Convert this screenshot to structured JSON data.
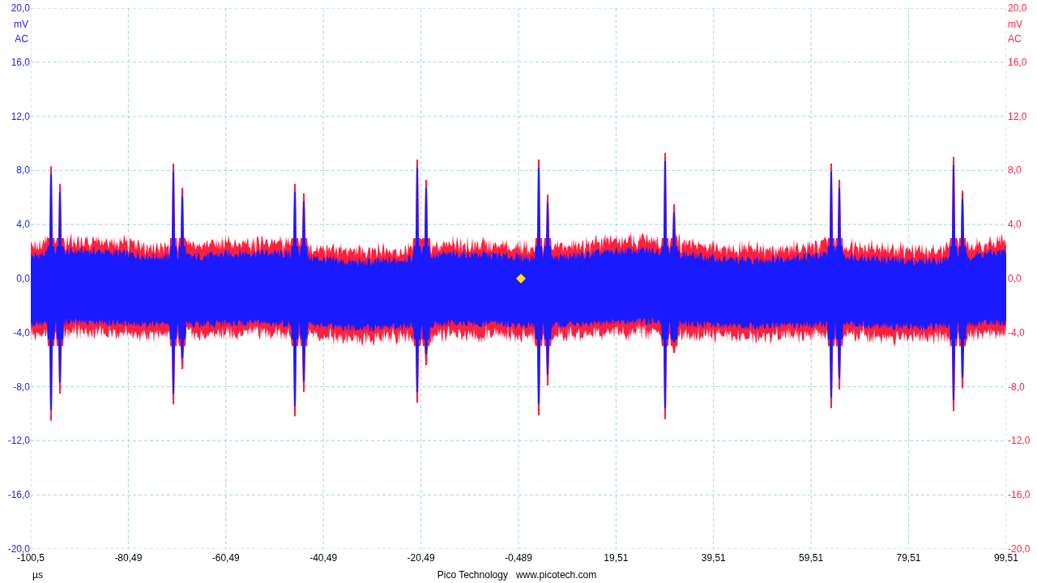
{
  "channels": [
    {
      "color": "#1a1aff",
      "unit": "mV",
      "coupling": "AC",
      "ticks": [
        "20,0",
        "16,0",
        "12,0",
        "8,0",
        "4,0",
        "0,0",
        "-4,0",
        "-8,0",
        "-12,0",
        "-16,0",
        "-20,0"
      ]
    },
    {
      "color": "#ff1f3f",
      "unit": "mV",
      "coupling": "AC",
      "ticks": [
        "20,0",
        "16,0",
        "12,0",
        "8,0",
        "4,0",
        "0,0",
        "-4,0",
        "-8,0",
        "-12,0",
        "-16,0",
        "-20,0"
      ]
    }
  ],
  "time_axis": {
    "ticks": [
      "-100,5",
      "-80,49",
      "-60,49",
      "-40,49",
      "-20,49",
      "-0,489",
      "19,51",
      "39,51",
      "59,51",
      "79,51",
      "99,51"
    ],
    "unit": "µs"
  },
  "footer": {
    "company": "Pico Technology",
    "website": "www.picotech.com"
  }
}
